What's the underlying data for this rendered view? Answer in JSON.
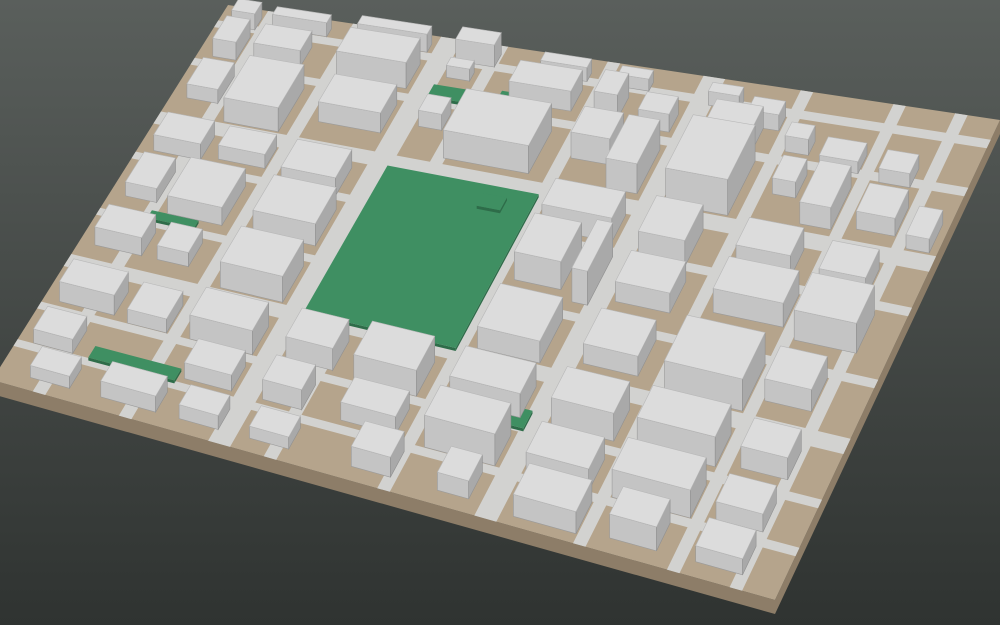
{
  "scene": {
    "background_top": "#5a5f5c",
    "background_bottom": "#2f3331",
    "ground_color": "#b5a48c",
    "ground_side_color": "#8d7d68",
    "road_color": "#d2d2d0",
    "building_top": "#dcdcdc",
    "building_left": "#c4c4c4",
    "building_right": "#a9a9a9",
    "park_color": "#3f8f62",
    "park_side_color": "#2e6c49"
  }
}
